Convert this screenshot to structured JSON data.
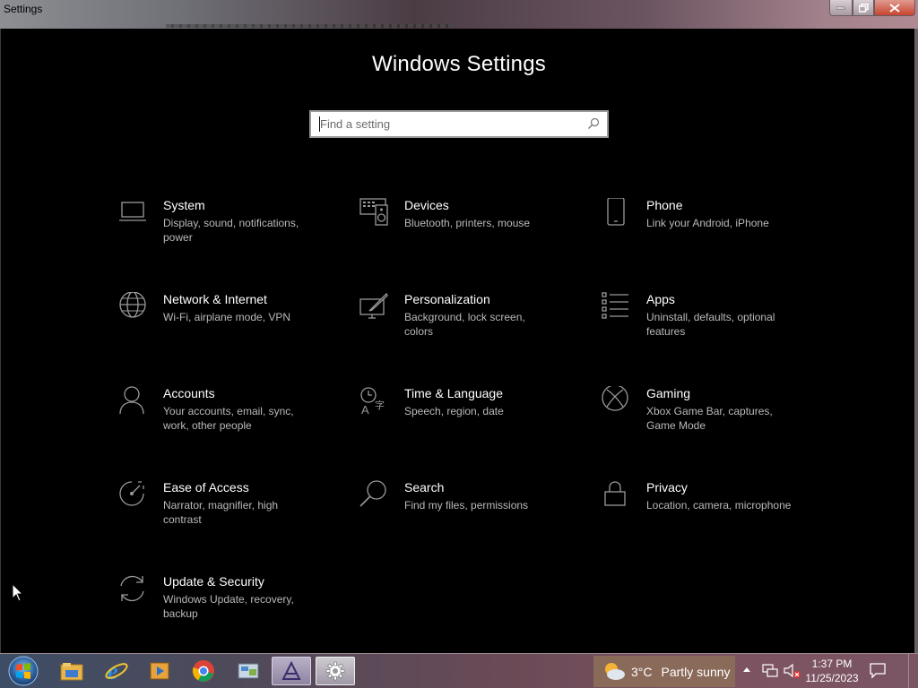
{
  "window": {
    "title": "Settings"
  },
  "page_title": "Windows Settings",
  "search": {
    "placeholder": "Find a setting"
  },
  "tiles": [
    {
      "name": "System",
      "desc": "Display, sound, notifications, power",
      "icon": "laptop-icon"
    },
    {
      "name": "Devices",
      "desc": "Bluetooth, printers, mouse",
      "icon": "keyboard-speaker-icon"
    },
    {
      "name": "Phone",
      "desc": "Link your Android, iPhone",
      "icon": "phone-icon"
    },
    {
      "name": "Network & Internet",
      "desc": "Wi-Fi, airplane mode, VPN",
      "icon": "globe-icon"
    },
    {
      "name": "Personalization",
      "desc": "Background, lock screen, colors",
      "icon": "paint-monitor-icon"
    },
    {
      "name": "Apps",
      "desc": "Uninstall, defaults, optional features",
      "icon": "apps-list-icon"
    },
    {
      "name": "Accounts",
      "desc": "Your accounts, email, sync, work, other people",
      "icon": "person-icon"
    },
    {
      "name": "Time & Language",
      "desc": "Speech, region, date",
      "icon": "time-language-icon"
    },
    {
      "name": "Gaming",
      "desc": "Xbox Game Bar, captures, Game Mode",
      "icon": "xbox-icon"
    },
    {
      "name": "Ease of Access",
      "desc": "Narrator, magnifier, high contrast",
      "icon": "ease-of-access-icon"
    },
    {
      "name": "Search",
      "desc": "Find my files, permissions",
      "icon": "search-icon"
    },
    {
      "name": "Privacy",
      "desc": "Location, camera, microphone",
      "icon": "lock-icon"
    },
    {
      "name": "Update & Security",
      "desc": "Windows Update, recovery, backup",
      "icon": "sync-icon"
    }
  ],
  "taskbar": {
    "apps": [
      "file-explorer-icon",
      "internet-explorer-icon",
      "media-player-icon",
      "chrome-icon",
      "control-panel-icon",
      "app-icon",
      "settings-gear-icon"
    ],
    "weather": {
      "temp": "3°C",
      "condition": "Partly sunny"
    },
    "clock": {
      "time": "1:37 PM",
      "date": "11/25/2023"
    }
  }
}
